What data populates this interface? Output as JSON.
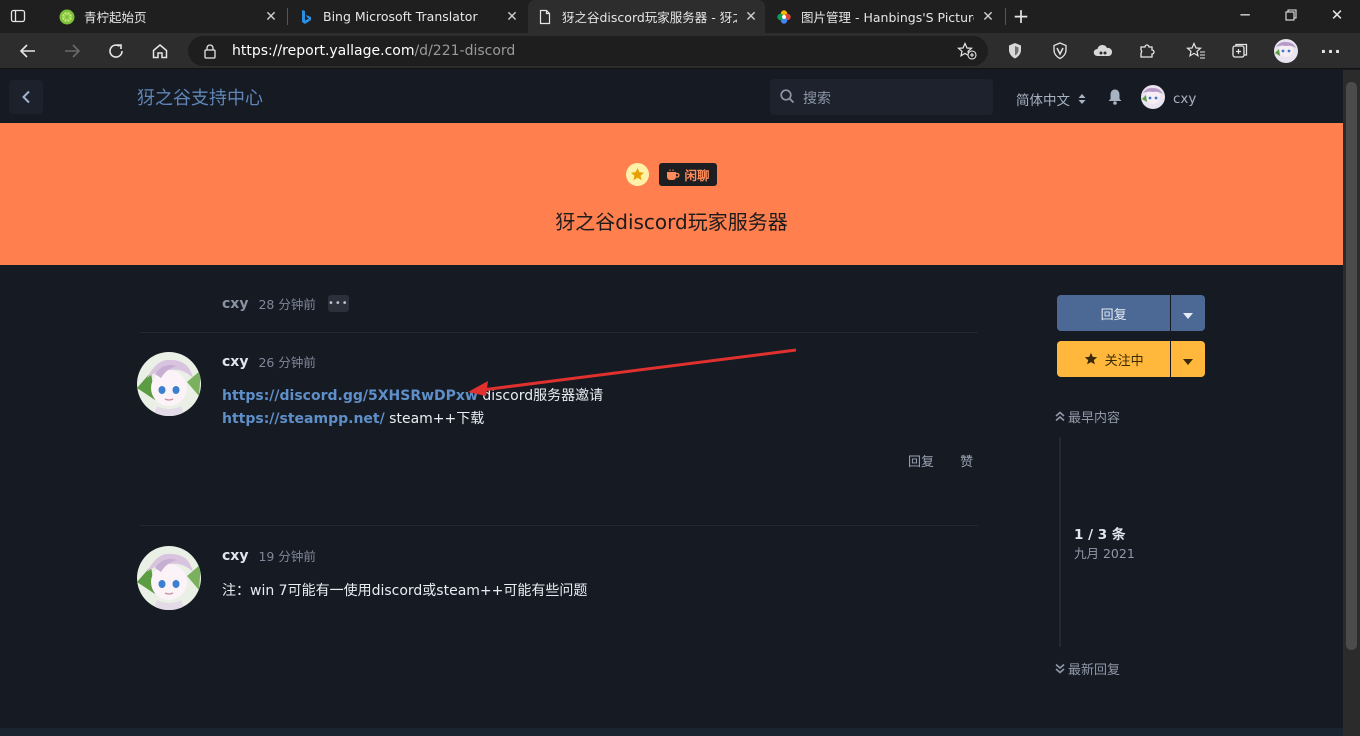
{
  "browser": {
    "tabs": [
      {
        "label": "青柠起始页",
        "icon": "lime-icon"
      },
      {
        "label": "Bing Microsoft Translator",
        "icon": "bing-icon"
      },
      {
        "label": "犽之谷discord玩家服务器 - 犽之",
        "icon": "page-icon"
      },
      {
        "label": "图片管理 - Hanbings'S Picture",
        "icon": "photos-icon"
      }
    ],
    "url_host": "https://report.yallage.com",
    "url_path": "/d/221-discord"
  },
  "site": {
    "title": "犽之谷支持中心",
    "search_placeholder": "搜索",
    "language": "简体中文",
    "username": "cxy"
  },
  "discussion": {
    "tag": "闲聊",
    "title": "犽之谷discord玩家服务器"
  },
  "posts": [
    {
      "author": "cxy",
      "time": "28 分钟前",
      "more": "•••"
    },
    {
      "author": "cxy",
      "time": "26 分钟前",
      "link1": "https://discord.gg/5XHSRwDPxw",
      "text1": " discord服务器邀请",
      "link2": "https://steampp.net/",
      "text2": " steam++下载",
      "reply_label": "回复",
      "like_label": "赞"
    },
    {
      "author": "cxy",
      "time": "19 分钟前",
      "body": "注：win 7可能有一使用discord或steam++可能有些问题"
    }
  ],
  "sidebar": {
    "reply_button": "回复",
    "follow_button": "关注中",
    "earliest": "最早内容",
    "count": "1 / 3 条",
    "date": "九月 2021",
    "latest": "最新回复"
  },
  "colors": {
    "hero": "#ff7f4f",
    "accent": "#4c6995",
    "follow": "#ffb83b",
    "link": "#5f8fc8"
  }
}
